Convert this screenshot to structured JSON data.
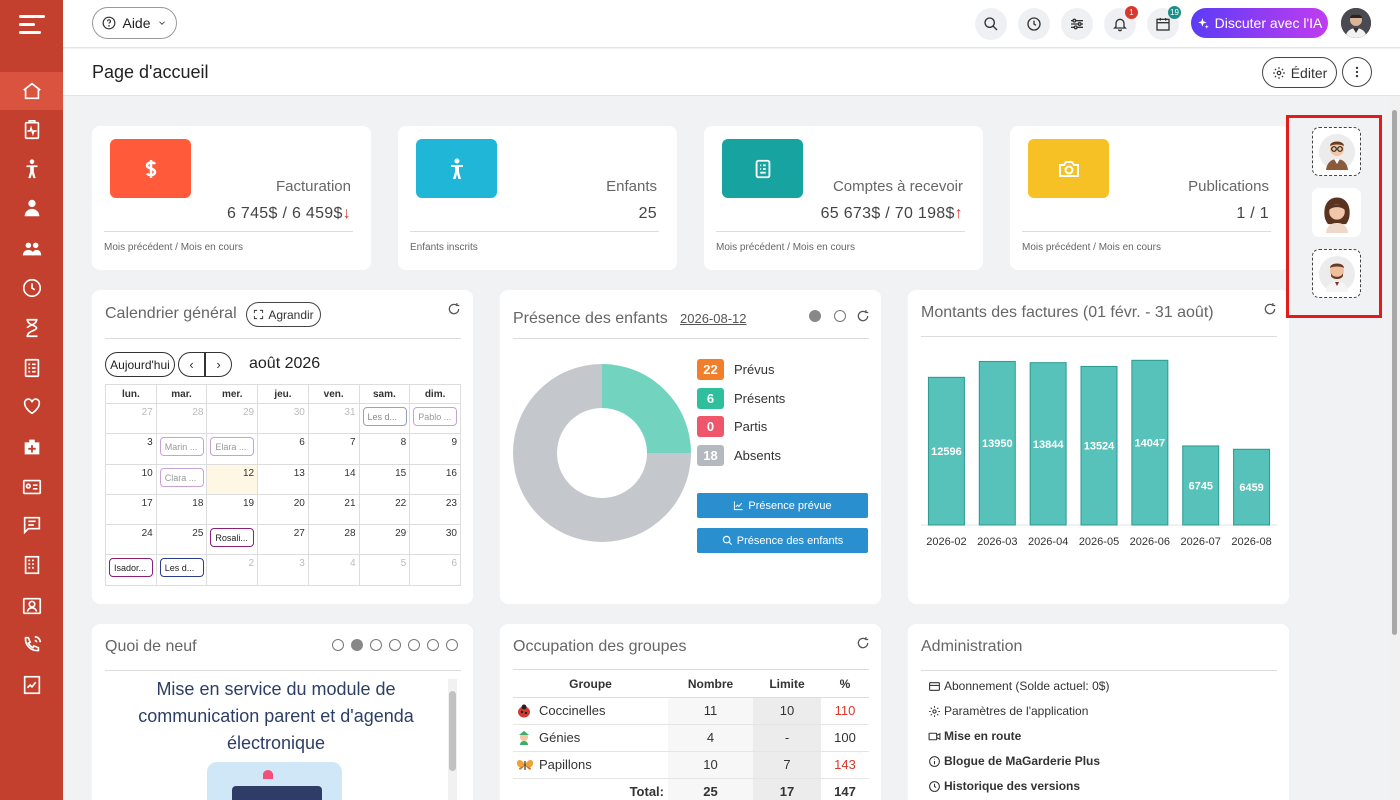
{
  "topbar": {
    "aide_label": "Aide",
    "notifications_count": "1",
    "calendar_count": "19",
    "ia_button_label": "Discuter avec l'IA"
  },
  "header": {
    "title": "Page d'accueil",
    "edit_label": "Éditer"
  },
  "sidebar": {
    "items": [
      "home-icon",
      "health-report-icon",
      "child-icon",
      "staff-icon",
      "group-icon",
      "history-icon",
      "hourglass-icon",
      "checklist-icon",
      "heart-icon",
      "medical-kit-icon",
      "id-card-icon",
      "message-icon",
      "building-icon",
      "contact-card-icon",
      "phone-ring-icon",
      "report-icon"
    ]
  },
  "stats": [
    {
      "label": "Facturation",
      "value": "6 745$ / 6 459$",
      "trend": "↓",
      "note": "Mois précédent / Mois en cours",
      "color": "#ff5b3b",
      "icon": "dollar-icon"
    },
    {
      "label": "Enfants",
      "value": "25",
      "trend": "",
      "note": "Enfants inscrits",
      "color": "#1fb6d8",
      "icon": "child-icon"
    },
    {
      "label": "Comptes à recevoir",
      "value": "65 673$ / 70 198$",
      "trend": "↑",
      "note": "Mois précédent / Mois en cours",
      "color": "#17a3a0",
      "icon": "invoice-icon"
    },
    {
      "label": "Publications",
      "value": "1 / 1",
      "trend": "",
      "note": "Mois précédent / Mois en cours",
      "color": "#f6c124",
      "icon": "camera-icon"
    }
  ],
  "calendar": {
    "title": "Calendrier général",
    "expand_label": "Agrandir",
    "today_label": "Aujourd'hui",
    "month": "août 2026",
    "weekdays": [
      "lun.",
      "mar.",
      "mer.",
      "jeu.",
      "ven.",
      "sam.",
      "dim."
    ],
    "weeks": [
      [
        "27",
        "28",
        "29",
        "30",
        "31",
        "",
        ""
      ],
      [
        "3",
        "",
        "",
        "6",
        "7",
        "8",
        "9"
      ],
      [
        "10",
        "",
        "12",
        "13",
        "14",
        "15",
        "16"
      ],
      [
        "17",
        "18",
        "19",
        "20",
        "21",
        "22",
        "23"
      ],
      [
        "24",
        "25",
        "",
        "27",
        "28",
        "29",
        "30"
      ],
      [
        "",
        "",
        "2",
        "3",
        "4",
        "5",
        "6"
      ]
    ],
    "events": {
      "w0d5": "Les d...",
      "w0d6": "Pablo ...",
      "w1d1": "Marin ...",
      "w1d2": "Elara ...",
      "w2d1": "Clara ...",
      "w4d2": "Rosali...",
      "w5d0": "Isador...",
      "w5d1": "Les d..."
    }
  },
  "presence": {
    "title": "Présence des enfants",
    "date": "2026-08-12",
    "items": [
      {
        "count": "22",
        "label": "Prévus",
        "color": "#f17e2a"
      },
      {
        "count": "6",
        "label": "Présents",
        "color": "#2fbf9c"
      },
      {
        "count": "0",
        "label": "Partis",
        "color": "#f0566b"
      },
      {
        "count": "18",
        "label": "Absents",
        "color": "#b4b8bf"
      }
    ],
    "donut": {
      "present": 6,
      "absent": 18
    },
    "btn_prevue": "Présence prévue",
    "btn_enfants": "Présence des enfants"
  },
  "invoices": {
    "title": "Montants des factures (01 févr. - 31 août)"
  },
  "chart_data": {
    "type": "bar",
    "categories": [
      "2026-02",
      "2026-03",
      "2026-04",
      "2026-05",
      "2026-06",
      "2026-07",
      "2026-08"
    ],
    "values": [
      12596,
      13950,
      13844,
      13524,
      14047,
      6745,
      6459
    ],
    "ylim": [
      0,
      14500
    ],
    "color": "#56c2b9"
  },
  "news": {
    "title": "Quoi de neuf",
    "headline": "Mise en service du module de communication parent et d'agenda électronique"
  },
  "groups": {
    "title": "Occupation des groupes",
    "headers": [
      "Groupe",
      "Nombre",
      "Limite",
      "%"
    ],
    "rows": [
      {
        "name": "Coccinelles",
        "nombre": "11",
        "limite": "10",
        "pct": "110",
        "over": true,
        "icon": "ladybug-icon"
      },
      {
        "name": "Génies",
        "nombre": "4",
        "limite": "-",
        "pct": "100",
        "over": false,
        "icon": "genie-icon"
      },
      {
        "name": "Papillons",
        "nombre": "10",
        "limite": "7",
        "pct": "143",
        "over": true,
        "icon": "butterfly-icon"
      }
    ],
    "total_label": "Total:",
    "total_nombre": "25",
    "total_limite": "17",
    "total_pct": "147"
  },
  "admin": {
    "title": "Administration",
    "items": [
      "Abonnement (Solde actuel: 0$)",
      "Paramètres de l'application",
      "Mise en route",
      "Blogue de MaGarderie Plus",
      "Historique des versions"
    ]
  }
}
